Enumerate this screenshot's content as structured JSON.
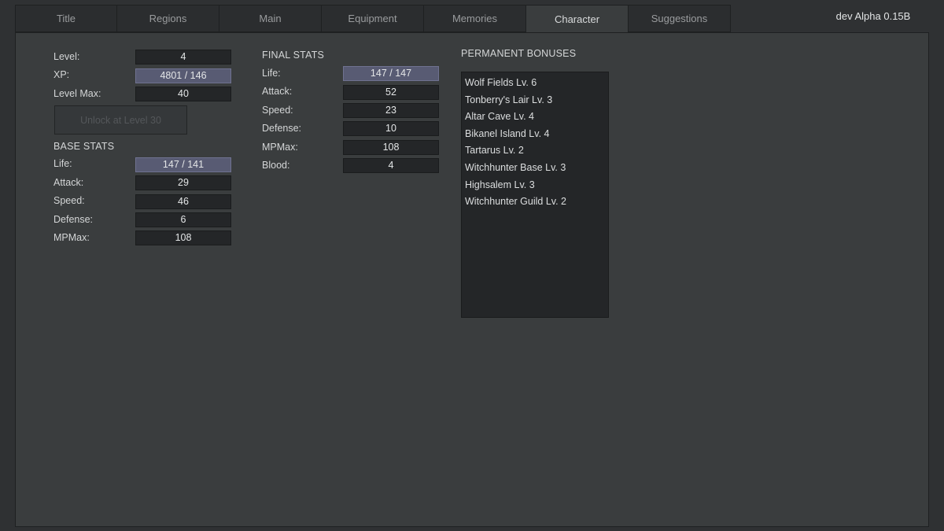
{
  "tabs": [
    {
      "label": "Title"
    },
    {
      "label": "Regions"
    },
    {
      "label": "Main"
    },
    {
      "label": "Equipment"
    },
    {
      "label": "Memories"
    },
    {
      "label": "Character",
      "active": true
    },
    {
      "label": "Suggestions"
    }
  ],
  "version": "dev Alpha 0.15B",
  "progress": {
    "level_label": "Level:",
    "level_value": "4",
    "xp_label": "XP:",
    "xp_value": "4801 / 146",
    "level_max_label": "Level Max:",
    "level_max_value": "40",
    "unlock_button_label": "Unlock at Level 30"
  },
  "base_stats": {
    "heading": "BASE STATS",
    "rows": [
      {
        "label": "Life:",
        "value": "147 / 141"
      },
      {
        "label": "Attack:",
        "value": "29"
      },
      {
        "label": "Speed:",
        "value": "46"
      },
      {
        "label": "Defense:",
        "value": "6"
      },
      {
        "label": "MPMax:",
        "value": "108"
      }
    ]
  },
  "final_stats": {
    "heading": "FINAL STATS",
    "rows": [
      {
        "label": "Life:",
        "value": "147 / 147"
      },
      {
        "label": "Attack:",
        "value": "52"
      },
      {
        "label": "Speed:",
        "value": "23"
      },
      {
        "label": "Defense:",
        "value": "10"
      },
      {
        "label": "MPMax:",
        "value": "108"
      },
      {
        "label": "Blood:",
        "value": "4"
      }
    ]
  },
  "permanent_bonuses": {
    "heading": "PERMANENT BONUSES",
    "items": [
      "Wolf Fields Lv. 6",
      "Tonberry's Lair Lv. 3",
      "Altar Cave Lv. 4",
      "Bikanel Island Lv. 4",
      "Tartarus Lv. 2",
      "Witchhunter Base Lv. 3",
      "Highsalem Lv. 3",
      "Witchhunter Guild Lv. 2"
    ]
  },
  "colors": {
    "background": "#2f3133",
    "panel": "#3a3d3e",
    "field": "#242628",
    "highlight_field": "#585b73"
  }
}
